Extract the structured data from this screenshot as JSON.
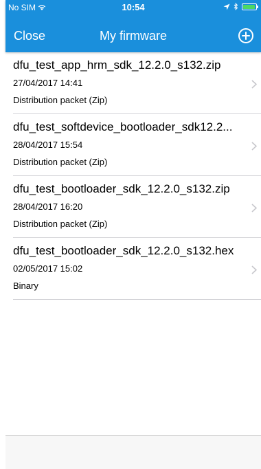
{
  "status_bar": {
    "carrier": "No SIM",
    "time": "10:54",
    "icons": [
      "wifi-icon",
      "location-arrow-icon",
      "bluetooth-icon",
      "battery-icon"
    ],
    "battery_color": "#4cd964"
  },
  "nav": {
    "close_label": "Close",
    "title": "My firmware",
    "add_icon": "plus-circle-icon",
    "bar_color": "#1a8fdc"
  },
  "firmware_list": [
    {
      "name": "dfu_test_app_hrm_sdk_12.2.0_s132.zip",
      "date": "27/04/2017 14:41",
      "type": "Distribution packet (Zip)"
    },
    {
      "name": "dfu_test_softdevice_bootloader_sdk12.2...",
      "date": "28/04/2017 15:54",
      "type": "Distribution packet (Zip)"
    },
    {
      "name": "dfu_test_bootloader_sdk_12.2.0_s132.zip",
      "date": "28/04/2017 16:20",
      "type": "Distribution packet (Zip)"
    },
    {
      "name": "dfu_test_bootloader_sdk_12.2.0_s132.hex",
      "date": "02/05/2017 15:02",
      "type": "Binary"
    }
  ]
}
